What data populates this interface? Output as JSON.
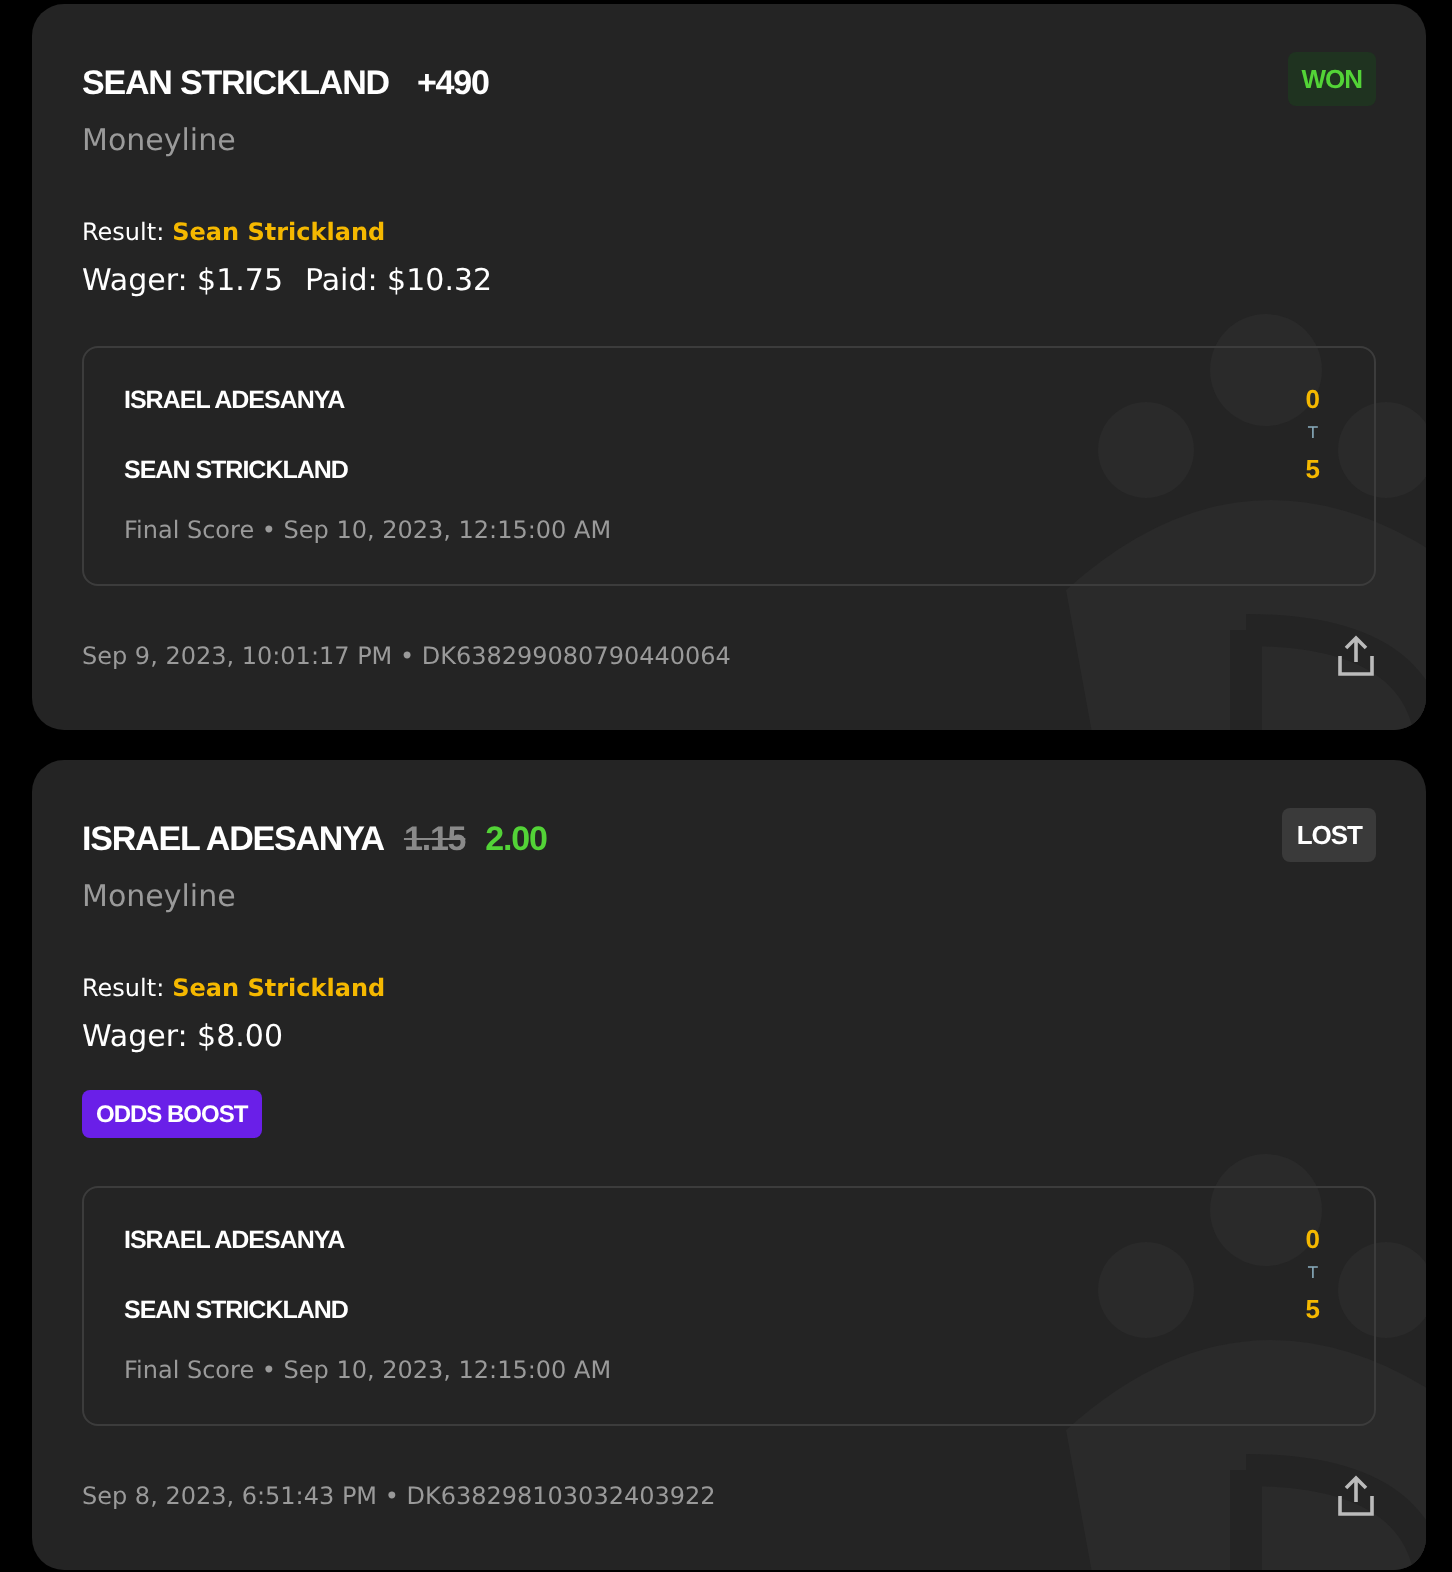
{
  "bets": [
    {
      "selection": "SEAN STRICKLAND",
      "odds": [
        {
          "text": "+490",
          "kind": "plain"
        }
      ],
      "status": {
        "text": "WON",
        "kind": "won"
      },
      "market": "Moneyline",
      "result_label": "Result:",
      "result_value": "Sean Strickland",
      "amounts": [
        "Wager: $1.75",
        "Paid: $10.32"
      ],
      "score": {
        "teams": [
          {
            "name": "ISRAEL ADESANYA",
            "score": "0"
          },
          {
            "name": "SEAN STRICKLAND",
            "score": "5"
          }
        ],
        "separator": "T",
        "status": "Final Score • Sep 10, 2023, 12:15:00 AM"
      },
      "placed": "Sep 9, 2023, 10:01:17 PM • DK638299080790440064"
    },
    {
      "selection": "ISRAEL ADESANYA",
      "odds": [
        {
          "text": "1.15",
          "kind": "old"
        },
        {
          "text": "2.00",
          "kind": "new"
        }
      ],
      "status": {
        "text": "LOST",
        "kind": "lost"
      },
      "market": "Moneyline",
      "result_label": "Result:",
      "result_value": "Sean Strickland",
      "amounts": [
        "Wager: $8.00"
      ],
      "boost": "ODDS BOOST",
      "score": {
        "teams": [
          {
            "name": "ISRAEL ADESANYA",
            "score": "0"
          },
          {
            "name": "SEAN STRICKLAND",
            "score": "5"
          }
        ],
        "separator": "T",
        "status": "Final Score • Sep 10, 2023, 12:15:00 AM"
      },
      "placed": "Sep 8, 2023, 6:51:43 PM • DK638298103032403922"
    }
  ]
}
